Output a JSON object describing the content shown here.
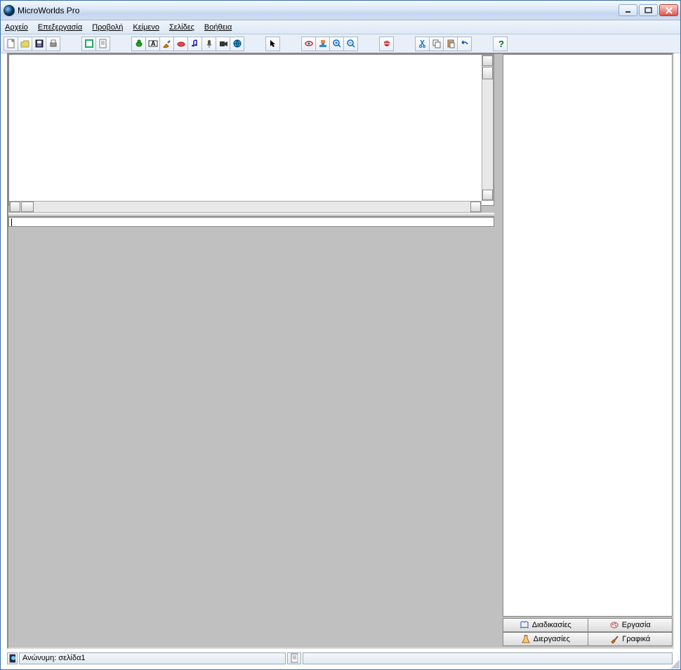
{
  "title": "MicroWorlds Pro",
  "menu": {
    "file": "Αρχείο",
    "edit": "Επεξεργασία",
    "view": "Προβολή",
    "text": "Κείμενο",
    "pages": "Σελίδες",
    "help": "Βοήθεια"
  },
  "status": {
    "main": "Ανώνυμη:  σελίδα1"
  },
  "tabs": {
    "procedures": "Διαδικασίες",
    "work": "Εργασία",
    "processes": "Διεργασίες",
    "graphics": "Γραφικά"
  }
}
